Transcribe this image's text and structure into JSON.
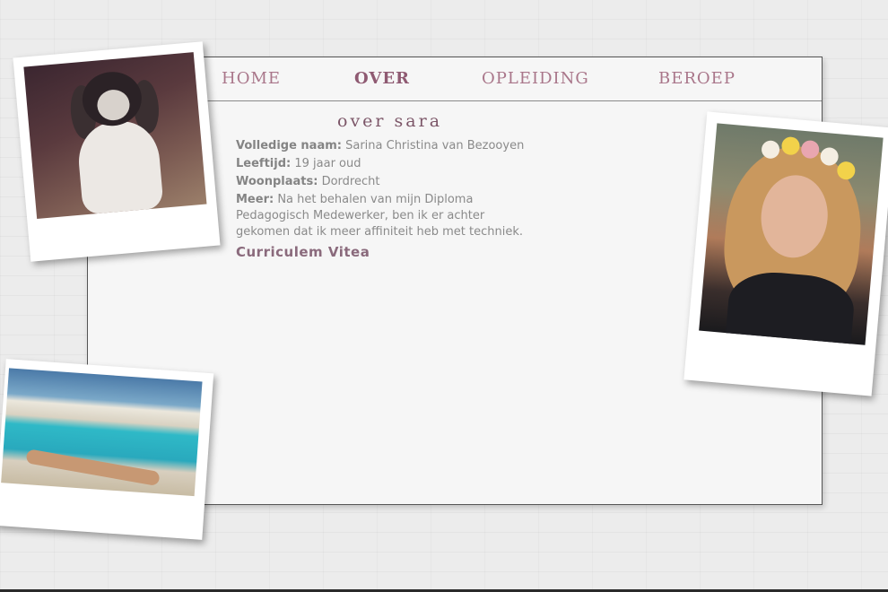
{
  "nav": {
    "items": [
      {
        "label": "HOME",
        "active": false
      },
      {
        "label": "OVER",
        "active": true
      },
      {
        "label": "OPLEIDING",
        "active": false
      },
      {
        "label": "BEROEP",
        "active": false
      }
    ]
  },
  "content": {
    "title": "over sara",
    "rows": [
      {
        "label": "Volledige naam:",
        "value": " Sarina Christina van Bezooyen"
      },
      {
        "label": "Leeftijd:",
        "value": " 19 jaar oud"
      },
      {
        "label": "Woonplaats:",
        "value": " Dordrecht"
      },
      {
        "label": "Meer:",
        "value": " Na het behalen van mijn Diploma Pedagogisch Medewerker, ben ik er achter gekomen dat ik meer affiniteit heb met techniek."
      }
    ],
    "cv_link": "Curriculem Vitea"
  },
  "photos": {
    "dog": "dog-photo",
    "selfie": "selfie-photo",
    "pool": "pool-photo"
  },
  "colors": {
    "accent": "#a9768a",
    "accent_dark": "#8f5a72",
    "panel_bg": "#f6f6f6",
    "text_grey": "#8a8a8a"
  }
}
